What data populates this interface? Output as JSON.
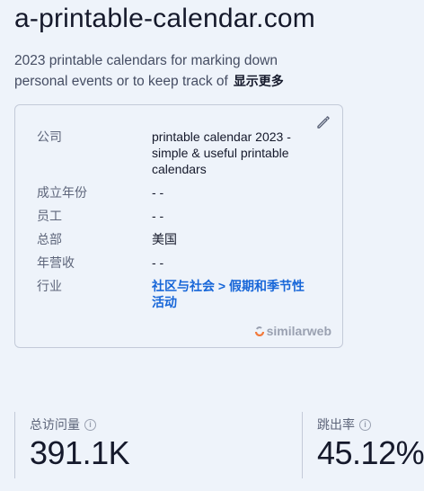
{
  "site": {
    "title": "a-printable-calendar.com",
    "description": "2023 printable calendars for marking down personal events or to keep track of",
    "show_more": "显示更多"
  },
  "card": {
    "rows": [
      {
        "label": "公司",
        "value": "printable calendar 2023 - simple & useful printable calendars"
      },
      {
        "label": "成立年份",
        "value": "- -"
      },
      {
        "label": "员工",
        "value": "- -"
      },
      {
        "label": "总部",
        "value": "美国"
      },
      {
        "label": "年营收",
        "value": "- -"
      },
      {
        "label": "行业",
        "value": "社区与社会 > 假期和季节性活动"
      }
    ],
    "brand": "similarweb",
    "edit_icon": "pencil-icon"
  },
  "stats": {
    "visits_label": "总访问量",
    "visits_value": "391.1K",
    "bounce_label": "跳出率",
    "bounce_value": "45.12%"
  },
  "colors": {
    "background": "#eef3fa",
    "link": "#1766d8",
    "border": "#c3cad8",
    "brand_orange": "#f27a3c"
  }
}
